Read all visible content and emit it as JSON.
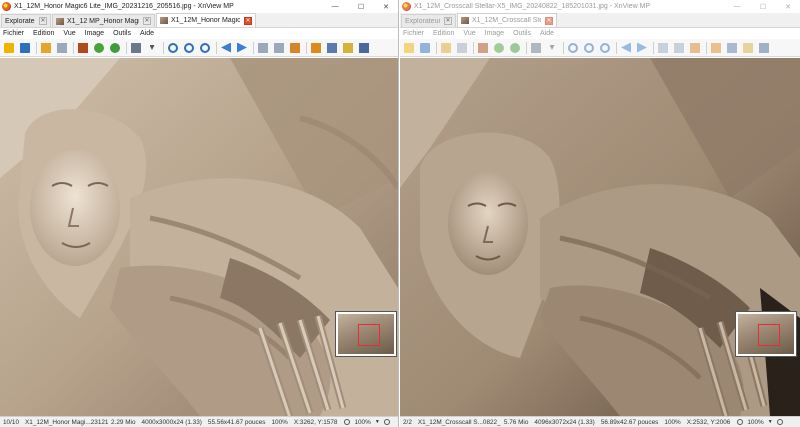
{
  "colors": {
    "accent_red": "#e24b2a",
    "stone_light": "#d9cbb9",
    "stone_mid": "#b3a08b",
    "stone_dark": "#6c5a48"
  },
  "left": {
    "title": "X1_12M_Honor Magic6 Lite_IMG_20231216_205516.jpg - XnView MP",
    "window_buttons": {
      "minimize": "—",
      "maximize": "☐",
      "close": "✕"
    },
    "tabs": [
      {
        "label": "Explorateur",
        "icon": "folder-icon",
        "close": "✕",
        "active": false
      },
      {
        "label": "X1_12 MP_Honor Magic6...",
        "icon": "image-icon",
        "close": "✕",
        "active": false
      },
      {
        "label": "X1_12M_Honor Magic6 ...",
        "icon": "image-icon",
        "close": "✕",
        "active": true
      }
    ],
    "menu": [
      "Fichier",
      "Edition",
      "Vue",
      "Image",
      "Outils",
      "Aide"
    ],
    "status": {
      "position": "10/10",
      "filename": "X1_12M_Honor Magi...231216_205516.jpg",
      "filesize": "2.29 Mio",
      "dimensions": "4000x3000x24 (1.33)",
      "print_size": "55.56x41.67 pouces",
      "zoom": "100%",
      "coords": "X:3262, Y:1578",
      "zoom_select": "100%"
    }
  },
  "right": {
    "title": "X1_12M_Crosscall Stellar-X5_IMG_20240822_185201031.jpg - XnView MP",
    "window_buttons": {
      "minimize": "—",
      "maximize": "☐",
      "close": "✕"
    },
    "tabs": [
      {
        "label": "Explorateur",
        "icon": "folder-icon",
        "close": "✕",
        "active": false
      },
      {
        "label": "X1_12M_Crosscall Ste...",
        "icon": "image-icon",
        "close": "✕",
        "active": true
      }
    ],
    "menu": [
      "Fichier",
      "Edition",
      "Vue",
      "Image",
      "Outils",
      "Aide"
    ],
    "status": {
      "position": "2/2",
      "filename": "X1_12M_Crosscall S...0822_185201031.jpg",
      "filesize": "5.76 Mio",
      "dimensions": "4096x3072x24 (1.33)",
      "print_size": "56.89x42.67 pouces",
      "zoom": "100%",
      "coords": "X:2532, Y:2006",
      "zoom_select": "100%"
    }
  },
  "toolbar_icons": [
    "browser-icon",
    "save-icon",
    "sep",
    "open-icon",
    "copy-icon",
    "sep",
    "fullscreen-icon",
    "refresh-icon",
    "slideshow-icon",
    "sep",
    "compare-icon",
    "dropdown-icon",
    "sep",
    "zoom-in-icon",
    "zoom-fit-icon",
    "zoom-out-icon",
    "sep",
    "prev-icon",
    "next-icon",
    "sep",
    "first-icon",
    "last-icon",
    "rotate-icon",
    "sep",
    "crop-icon",
    "effects-icon",
    "adjust-icon",
    "print-icon"
  ]
}
